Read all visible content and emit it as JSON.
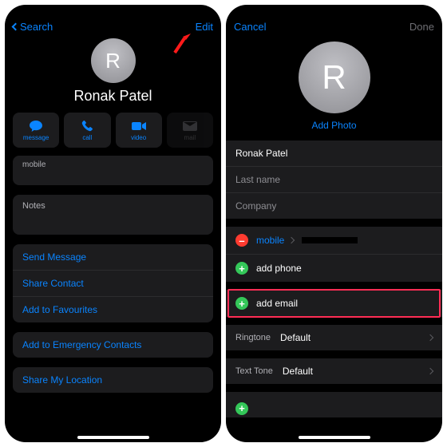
{
  "left": {
    "nav": {
      "back": "Search",
      "edit": "Edit"
    },
    "avatar_initial": "R",
    "name": "Ronak Patel",
    "actions": {
      "message": "message",
      "call": "call",
      "video": "video",
      "mail": "mail"
    },
    "phone_label": "mobile",
    "notes_label": "Notes",
    "links": {
      "send_message": "Send Message",
      "share_contact": "Share Contact",
      "add_fav": "Add to Favourites",
      "add_emergency": "Add to Emergency Contacts",
      "share_loc": "Share My Location"
    }
  },
  "right": {
    "nav": {
      "cancel": "Cancel",
      "done": "Done"
    },
    "avatar_initial": "R",
    "add_photo": "Add Photo",
    "fields": {
      "first_name": "Ronak Patel",
      "last_name_ph": "Last name",
      "company_ph": "Company"
    },
    "phone": {
      "mobile_label": "mobile",
      "add_phone": "add phone"
    },
    "email": {
      "add_email": "add email"
    },
    "ringtone": {
      "label": "Ringtone",
      "value": "Default"
    },
    "texttone": {
      "label": "Text Tone",
      "value": "Default"
    }
  }
}
